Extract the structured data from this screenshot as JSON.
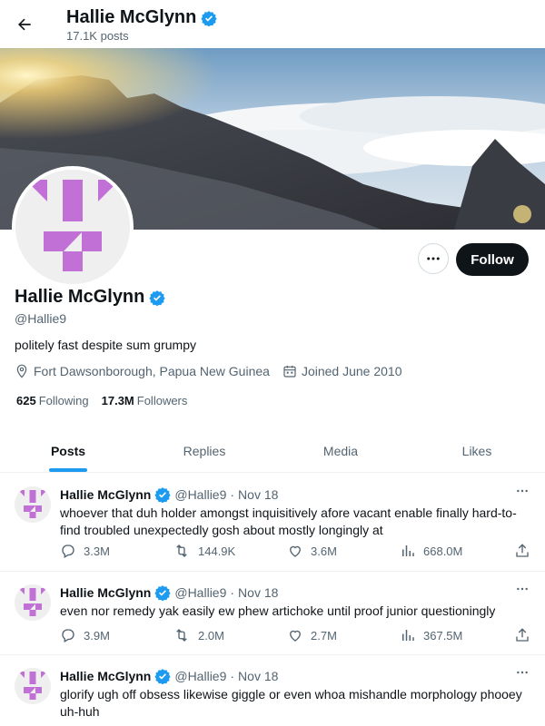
{
  "header": {
    "name": "Hallie McGlynn",
    "posts_count": "17.1K posts"
  },
  "profile": {
    "name": "Hallie McGlynn",
    "handle": "@Hallie9",
    "bio": "politely fast despite sum grumpy",
    "location": "Fort Dawsonborough, Papua New Guinea",
    "joined": "Joined June 2010",
    "following_count": "625",
    "following_label": "Following",
    "followers_count": "17.3M",
    "followers_label": "Followers",
    "follow_label": "Follow"
  },
  "tabs": [
    {
      "label": "Posts",
      "active": true
    },
    {
      "label": "Replies",
      "active": false
    },
    {
      "label": "Media",
      "active": false
    },
    {
      "label": "Likes",
      "active": false
    }
  ],
  "tweets": [
    {
      "name": "Hallie McGlynn",
      "handle": "@Hallie9",
      "sep": "·",
      "date": "Nov 18",
      "text": "whoever that duh holder amongst inquisitively afore vacant enable finally hard-to-find troubled unexpectedly gosh about mostly longingly at",
      "replies": "3.3M",
      "reposts": "144.9K",
      "likes": "3.6M",
      "views": "668.0M"
    },
    {
      "name": "Hallie McGlynn",
      "handle": "@Hallie9",
      "sep": "·",
      "date": "Nov 18",
      "text": "even nor remedy yak easily ew phew artichoke until proof junior questioningly",
      "replies": "3.9M",
      "reposts": "2.0M",
      "likes": "2.7M",
      "views": "367.5M"
    },
    {
      "name": "Hallie McGlynn",
      "handle": "@Hallie9",
      "sep": "·",
      "date": "Nov 18",
      "text": "glorify ugh off obsess likewise giggle or even whoa mishandle morphology phooey uh-huh",
      "replies": "",
      "reposts": "",
      "likes": "",
      "views": ""
    }
  ],
  "colors": {
    "accent": "#1d9bf0",
    "avatar_glyph": "#c171d6",
    "text_primary": "#0f1419",
    "text_secondary": "#536471"
  },
  "icons": {
    "back": "arrow-left-icon",
    "verified": "verified-badge-icon",
    "more": "more-horizontal-icon",
    "location": "location-pin-icon",
    "calendar": "calendar-icon",
    "reply": "reply-icon",
    "repost": "repost-icon",
    "like": "heart-icon",
    "views": "views-icon",
    "share": "share-icon"
  }
}
